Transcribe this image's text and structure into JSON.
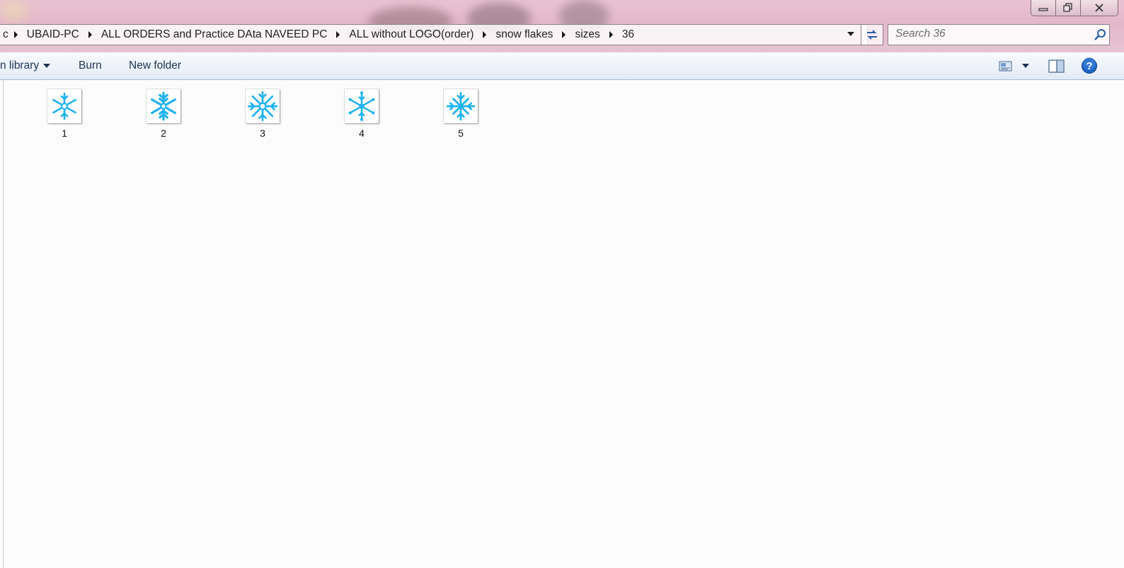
{
  "window": {
    "controls": [
      "minimize",
      "restore",
      "close"
    ]
  },
  "address_bar": {
    "crumbs": [
      "UBAID-PC",
      "ALL ORDERS and Practice DAta NAVEED PC",
      "ALL without LOGO(order)",
      "snow flakes",
      "sizes",
      "36"
    ],
    "truncated_prefix": "c"
  },
  "search": {
    "placeholder": "Search 36"
  },
  "commandbar": {
    "include_in_library_label": "n library",
    "burn_label": "Burn",
    "new_folder_label": "New folder"
  },
  "files": [
    {
      "name": "1",
      "icon": "snowflake-icon"
    },
    {
      "name": "2",
      "icon": "snowflake-icon"
    },
    {
      "name": "3",
      "icon": "snowflake-icon"
    },
    {
      "name": "4",
      "icon": "snowflake-icon"
    },
    {
      "name": "5",
      "icon": "snowflake-icon"
    }
  ],
  "colors": {
    "snowflake": "#1fb2f0",
    "titlebar": "#e6bfcf",
    "commandbar": "#eef3fa"
  }
}
